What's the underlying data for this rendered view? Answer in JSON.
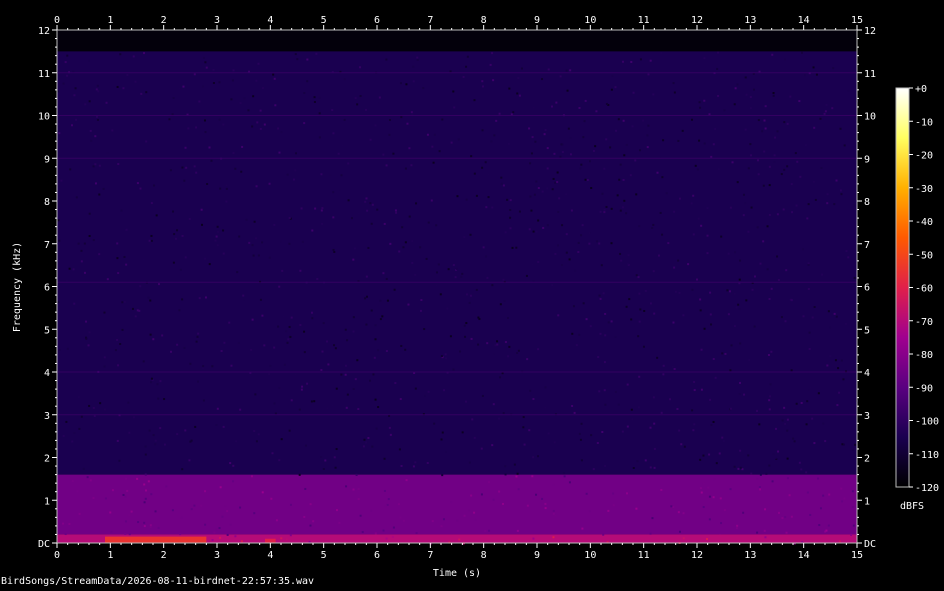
{
  "chart_data": {
    "type": "heatmap",
    "xlabel": "Time (s)",
    "ylabel": "Frequency (kHz)",
    "xlim": [
      0,
      15
    ],
    "ylim": [
      0,
      12
    ],
    "x_ticks": [
      "0",
      "1",
      "2",
      "3",
      "4",
      "5",
      "6",
      "7",
      "8",
      "9",
      "10",
      "11",
      "12",
      "13",
      "14",
      "15"
    ],
    "y_ticks": [
      "DC",
      "1",
      "2",
      "3",
      "4",
      "5",
      "6",
      "7",
      "8",
      "9",
      "10",
      "11",
      "12"
    ],
    "colorbar": {
      "label": "dBFS",
      "range": [
        -120,
        0
      ],
      "ticks": [
        "+0",
        "-10",
        "-20",
        "-30",
        "-40",
        "-50",
        "-60",
        "-70",
        "-80",
        "-90",
        "-100",
        "-110",
        "-120"
      ],
      "colors": [
        "#000000",
        "#1a0050",
        "#5a0080",
        "#a0008f",
        "#e0204a",
        "#ff5a00",
        "#ffb000",
        "#ffff60",
        "#ffffff"
      ]
    },
    "bands": [
      {
        "freq_range_khz": [
          1.6,
          11.5
        ],
        "level_dbfs": -105
      },
      {
        "freq_range_khz": [
          0.2,
          1.6
        ],
        "level_dbfs": -85
      },
      {
        "freq_range_khz": [
          0.0,
          0.2
        ],
        "level_dbfs": -70
      }
    ],
    "hotspots": [
      {
        "time_s": [
          0.9,
          2.8
        ],
        "freq_khz": [
          0.0,
          0.15
        ],
        "level_dbfs": -55
      },
      {
        "time_s": [
          3.9,
          4.1
        ],
        "freq_khz": [
          0.0,
          0.1
        ],
        "level_dbfs": -60
      }
    ]
  },
  "filename": "BirdSongs/StreamData/2026-08-11-birdnet-22:57:35.wav"
}
